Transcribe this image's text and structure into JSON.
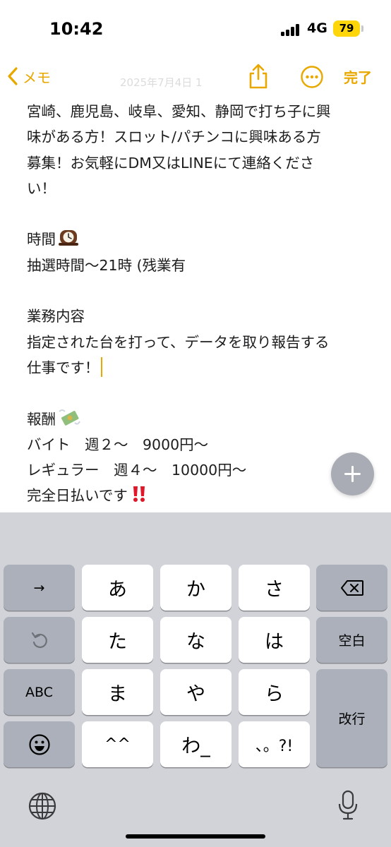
{
  "status_bar": {
    "time": "10:42",
    "network": "4G",
    "battery": "79"
  },
  "nav": {
    "back_label": "メモ",
    "date_faded": "2025年7月4日 1",
    "done_label": "完了"
  },
  "note": {
    "lines": [
      "宮崎、鹿児島、岐阜、愛知、静岡で打ち子に興",
      "味がある方！スロット/パチンコに興味ある方",
      "募集！お気軽にDM又はLINEにて連絡くださ",
      "い！",
      "",
      "時間",
      "抽選時間〜21時 (残業有",
      "",
      "業務内容",
      "指定された台を打って、データを取り報告する",
      "仕事です！",
      "",
      "報酬",
      "バイト　週２〜　9000円〜",
      "レギュラー　週４〜　10000円〜",
      "完全日払いです"
    ]
  },
  "keyboard": {
    "arrow_key": "→",
    "row1": [
      "あ",
      "か",
      "さ"
    ],
    "row2": [
      "た",
      "な",
      "は"
    ],
    "row3": [
      "ま",
      "や",
      "ら"
    ],
    "row4": [
      "^^",
      "わ_",
      "、。?!"
    ],
    "space_key": "空白",
    "abc_key": "ABC",
    "return_key": "改行"
  },
  "colors": {
    "accent": "#e9a800",
    "keyboard_bg": "#d1d3d9",
    "key_dark": "#abb0ba",
    "key_light": "#ffffff"
  },
  "icons": [
    "chevron-left-icon",
    "share-icon",
    "more-icon",
    "plus-icon",
    "backspace-icon",
    "undo-icon",
    "emoji-icon",
    "globe-icon",
    "microphone-icon",
    "clock-emoji",
    "money-emoji",
    "double-exclamation-emoji"
  ]
}
